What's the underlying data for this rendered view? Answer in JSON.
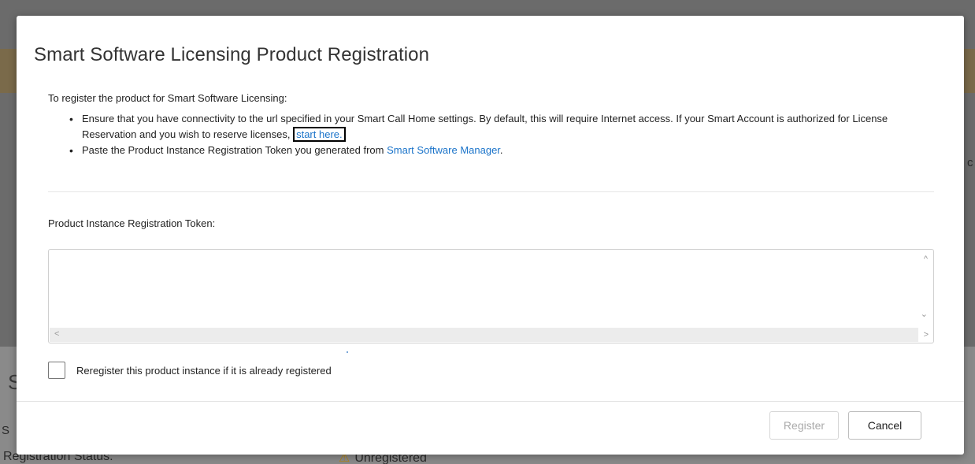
{
  "background": {
    "registration_label": "Registration Status:",
    "registration_value": "Unregistered",
    "warning_glyph": "⚠",
    "heading_fragment": "S",
    "sub_fragment": "S",
    "right_fragment": "c"
  },
  "modal": {
    "title": "Smart Software Licensing Product Registration",
    "intro": "To register the product for Smart Software Licensing:",
    "bullet1": {
      "text": "Ensure that you have connectivity to the url specified in your Smart Call Home settings. By default, this will require Internet access. If your Smart Account is authorized for License Reservation and you wish to reserve licenses,",
      "link": "start here."
    },
    "bullet2": {
      "text": "Paste the Product Instance Registration Token you generated from",
      "link": "Smart Software Manager",
      "suffix": "."
    },
    "token_label": "Product Instance Registration Token:",
    "token_value": "",
    "reregister_label": "Reregister this product instance if it is already registered",
    "register_button": "Register",
    "cancel_button": "Cancel"
  },
  "colors": {
    "link": "#1a73c9",
    "overlay": "#6e6e6e",
    "warning": "#b8860b"
  }
}
